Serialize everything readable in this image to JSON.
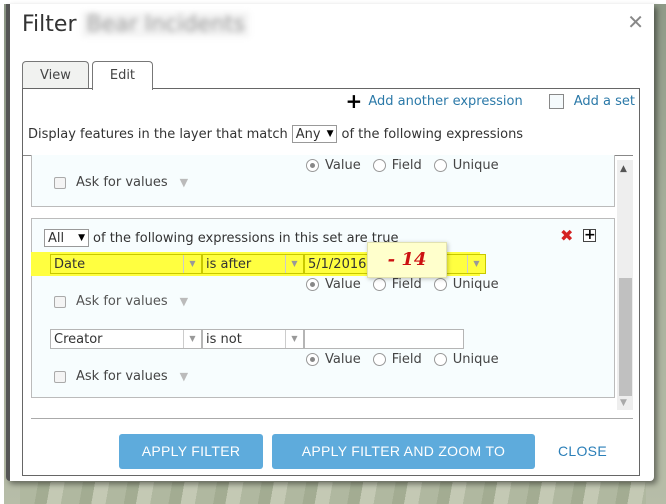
{
  "dialog": {
    "title": "Filter",
    "title_suffix_redacted": "Bear Incidents",
    "close_icon": "close-icon"
  },
  "tabs": [
    {
      "label": "View",
      "active": false
    },
    {
      "label": "Edit",
      "active": true
    }
  ],
  "actions": {
    "add_expression": "Add another expression",
    "add_set": "Add a set"
  },
  "match": {
    "prefix": "Display features in the layer that match",
    "value": "Any",
    "suffix": "of the following expressions"
  },
  "set1": {
    "radios": [
      {
        "label": "Value",
        "checked": true
      },
      {
        "label": "Field",
        "checked": false
      },
      {
        "label": "Unique",
        "checked": false
      }
    ],
    "ask_for_values": "Ask for values"
  },
  "set2": {
    "set_match_value": "All",
    "set_match_text": "of the following expressions in this set are true",
    "expressions": [
      {
        "field": "Date",
        "operator": "is after",
        "value": "5/1/2016",
        "highlighted": true,
        "radios": [
          {
            "label": "Value",
            "checked": true
          },
          {
            "label": "Field",
            "checked": false
          },
          {
            "label": "Unique",
            "checked": false
          }
        ],
        "ask_for_values": "Ask for values"
      },
      {
        "field": "Creator",
        "operator": "is not",
        "value": "",
        "highlighted": false,
        "radios": [
          {
            "label": "Value",
            "checked": true
          },
          {
            "label": "Field",
            "checked": false
          },
          {
            "label": "Unique",
            "checked": false
          }
        ],
        "ask_for_values": "Ask for values"
      }
    ]
  },
  "annotation": {
    "text": "- 14",
    "color": "#cc1111"
  },
  "buttons": {
    "apply_filter": "APPLY FILTER",
    "apply_filter_zoom": "APPLY FILTER AND ZOOM TO",
    "close": "CLOSE"
  },
  "colors": {
    "primary_button": "#5eabdc",
    "link": "#2b79a8",
    "highlight": "#ffff40"
  }
}
